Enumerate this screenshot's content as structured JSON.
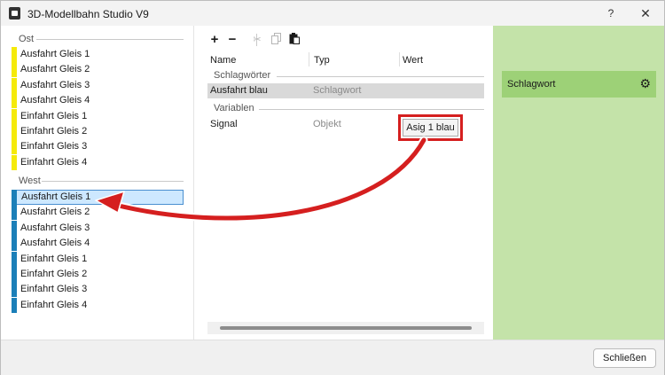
{
  "window": {
    "title": "3D-Modellbahn Studio V9",
    "help_label": "?",
    "close_label": "✕"
  },
  "left": {
    "groups": [
      {
        "name": "Ost",
        "color": "#f5ea0a",
        "items": [
          "Ausfahrt Gleis 1",
          "Ausfahrt Gleis 2",
          "Ausfahrt Gleis 3",
          "Ausfahrt Gleis 4",
          "Einfahrt Gleis 1",
          "Einfahrt Gleis 2",
          "Einfahrt Gleis 3",
          "Einfahrt Gleis 4"
        ]
      },
      {
        "name": "West",
        "color": "#1b7fb8",
        "selected_index": 0,
        "items": [
          "Ausfahrt Gleis 1",
          "Ausfahrt Gleis 2",
          "Ausfahrt Gleis 3",
          "Ausfahrt Gleis 4",
          "Einfahrt Gleis 1",
          "Einfahrt Gleis 2",
          "Einfahrt Gleis 3",
          "Einfahrt Gleis 4"
        ]
      }
    ]
  },
  "toolbar": {
    "add_icon": "plus-icon",
    "remove_icon": "minus-icon",
    "cut_icon": "scissors-icon",
    "copy_icon": "copy-icon",
    "paste_icon": "clipboard-icon"
  },
  "table": {
    "columns": [
      "Name",
      "Typ",
      "Wert"
    ],
    "sections": [
      {
        "title": "Schlagwörter",
        "rows": [
          {
            "name": "Ausfahrt blau",
            "type": "Schlagwort",
            "value": ""
          }
        ]
      },
      {
        "title": "Variablen",
        "rows": [
          {
            "name": "Signal",
            "type": "Objekt",
            "value": "Asig 1 blau"
          }
        ]
      }
    ]
  },
  "right": {
    "keyword_label": "Schlagwort",
    "gear_icon": "gear-icon"
  },
  "footer": {
    "close_button": "Schließen"
  },
  "colors": {
    "highlight_red": "#d51f1f",
    "panel_green": "#c4e3a9",
    "card_green": "#9dd177",
    "selection_blue": "#cde8ff"
  }
}
